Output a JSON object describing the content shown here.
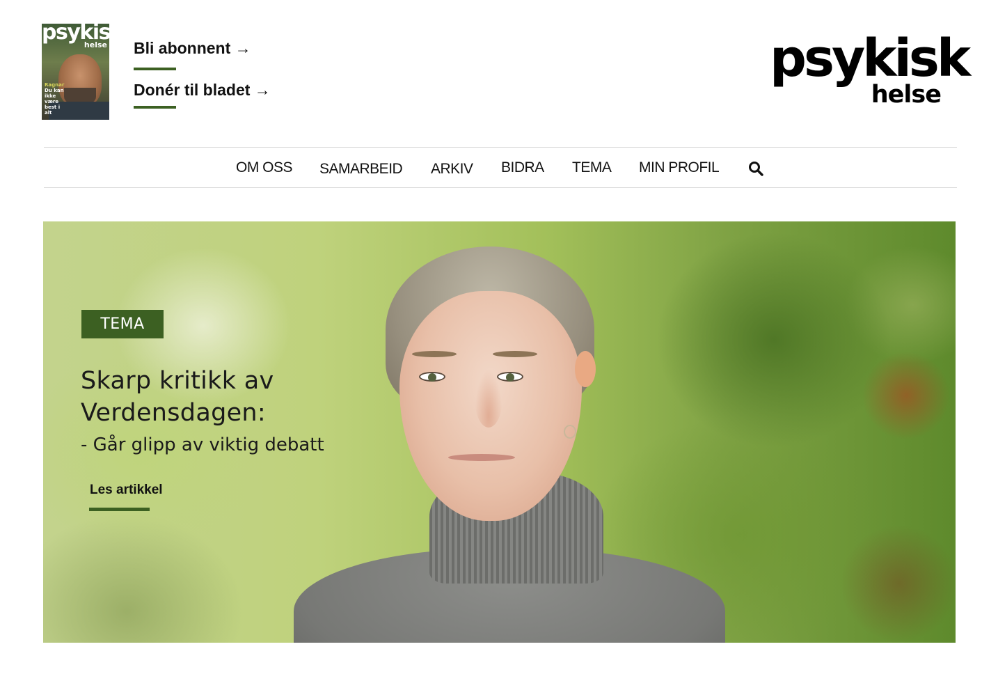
{
  "header": {
    "cover": {
      "title": "psykisk",
      "subtitle": "helse",
      "cover_line_highlight": "Ragnar",
      "cover_line": "Du kan ikke være best i alt"
    },
    "subscribe_label": "Bli abonnent →",
    "donate_label": "Donér til bladet →",
    "logo": {
      "line1": "psykisk",
      "line2": "helse"
    }
  },
  "nav": {
    "items": [
      "OM OSS",
      "SAMARBEID",
      "ARKIV",
      "BIDRA",
      "TEMA",
      "MIN PROFIL"
    ],
    "search_icon": "search-icon"
  },
  "hero": {
    "badge": "TEMA",
    "headline_line1": "Skarp kritikk av",
    "headline_line2": "Verdensdagen:",
    "subheadline": "- Går glipp av viktig debatt",
    "cta_label": "Les artikkel"
  },
  "colors": {
    "accent_green": "#3c6022",
    "text": "#111111",
    "divider": "#d8d8d8"
  }
}
